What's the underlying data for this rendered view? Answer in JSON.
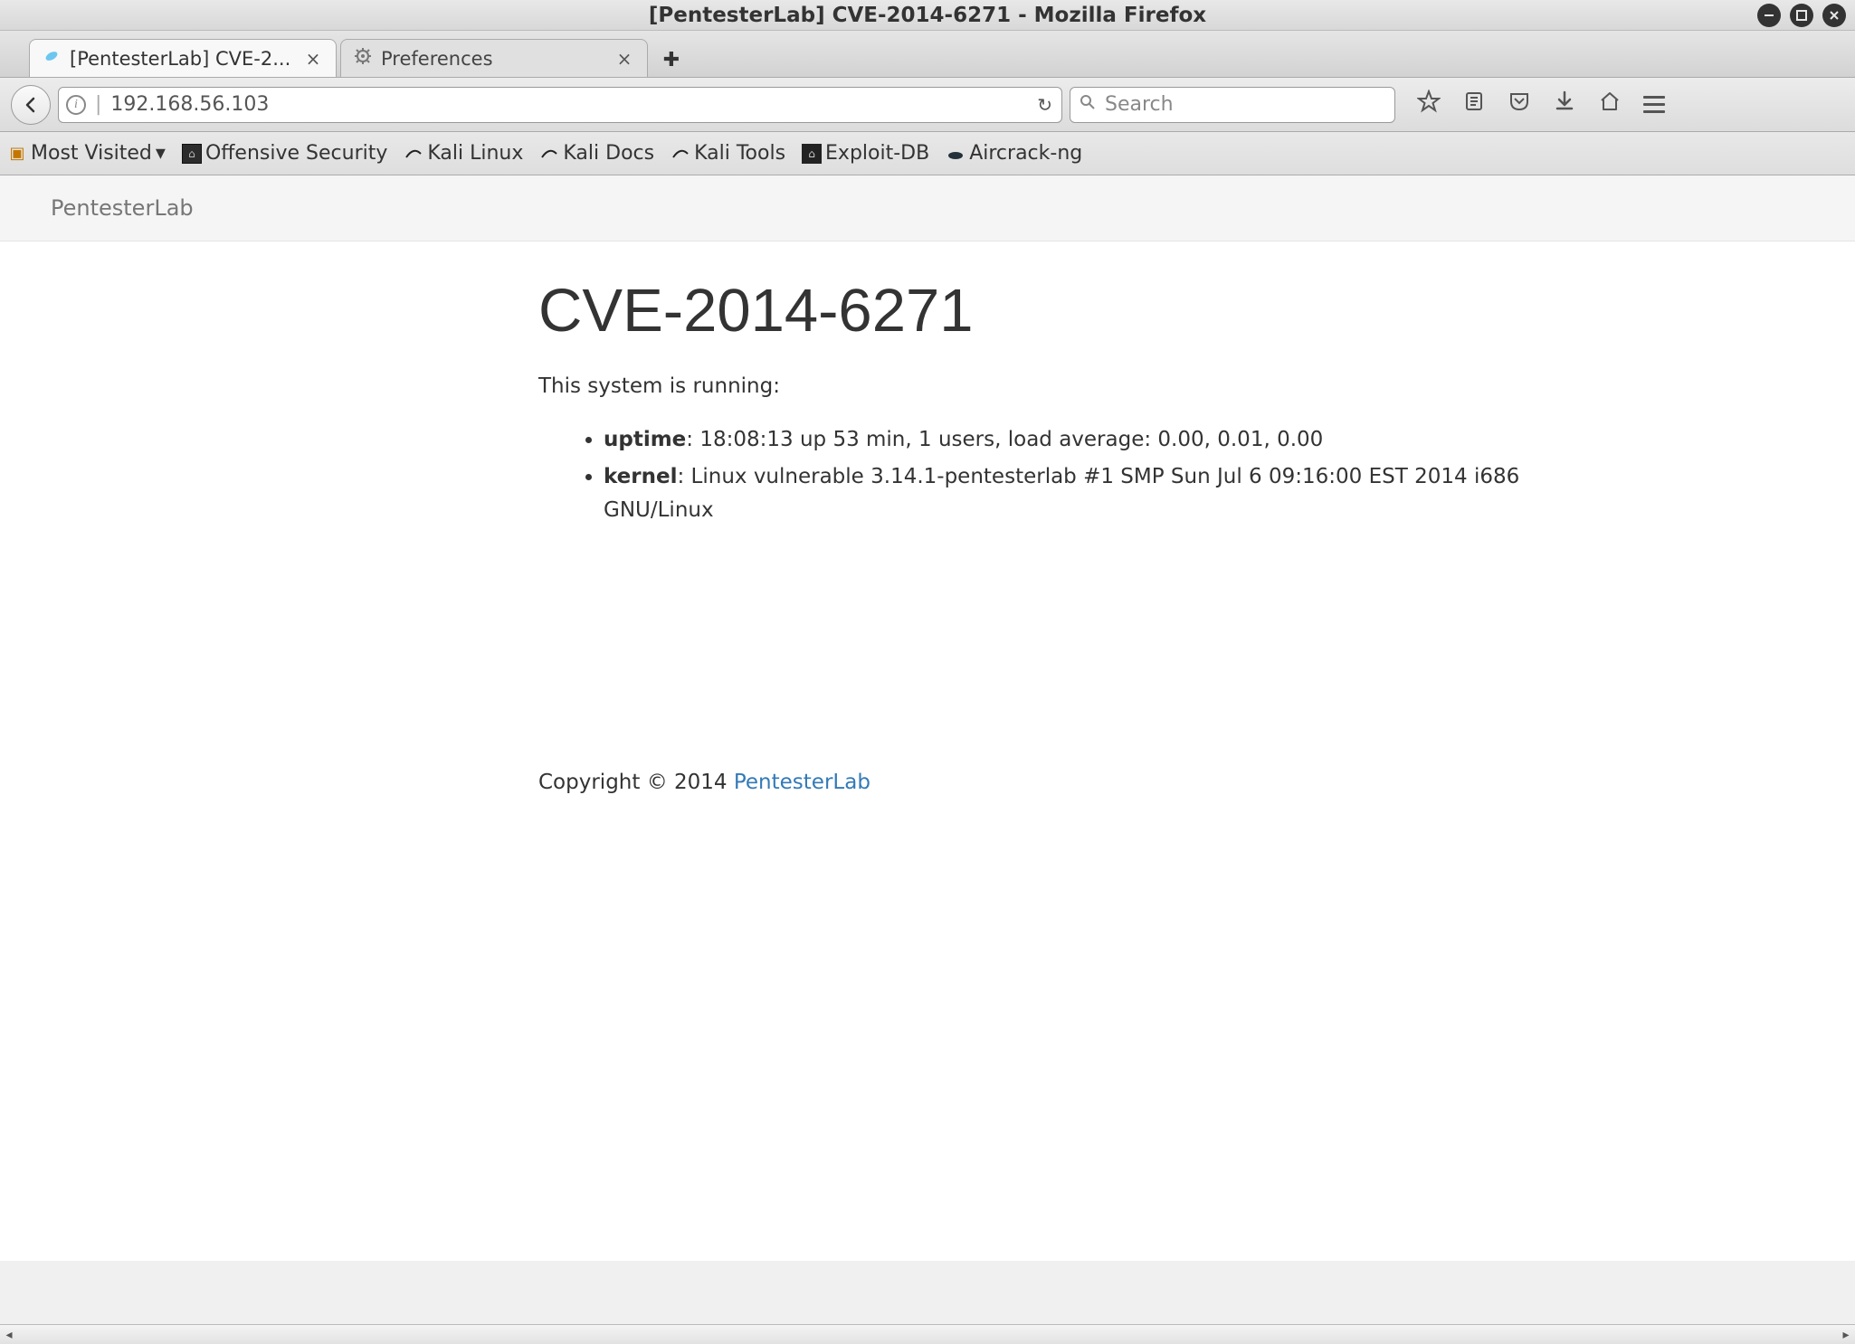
{
  "window": {
    "title": "[PentesterLab] CVE-2014-6271 - Mozilla Firefox"
  },
  "tabs": [
    {
      "label": "[PentesterLab] CVE-2...",
      "active": true
    },
    {
      "label": "Preferences",
      "active": false
    }
  ],
  "url_bar": {
    "address": "192.168.56.103"
  },
  "search": {
    "placeholder": "Search"
  },
  "bookmarks": {
    "most_visited": "Most Visited",
    "offensive": "Offensive Security",
    "kali_linux": "Kali Linux",
    "kali_docs": "Kali Docs",
    "kali_tools": "Kali Tools",
    "exploit_db": "Exploit-DB",
    "aircrack": "Aircrack-ng"
  },
  "page": {
    "brand": "PentesterLab",
    "heading": "CVE-2014-6271",
    "lead": "This system is running:",
    "items": [
      {
        "label": "uptime",
        "value": ": 18:08:13 up 53 min, 1 users, load average: 0.00, 0.01, 0.00"
      },
      {
        "label": "kernel",
        "value": ": Linux vulnerable 3.14.1-pentesterlab #1 SMP Sun Jul 6 09:16:00 EST 2014 i686 GNU/Linux"
      }
    ],
    "footer_text": "Copyright © 2014 ",
    "footer_link": "PentesterLab"
  }
}
